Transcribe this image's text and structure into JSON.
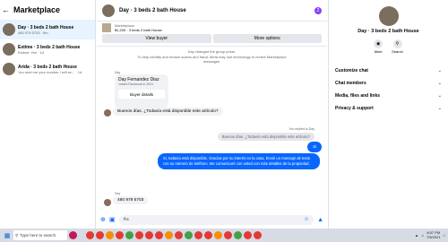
{
  "left": {
    "title": "Marketplace",
    "conversations": [
      {
        "title": "Day · 3 beds 2 bath House",
        "sub": "480 979 5703 · 8m"
      },
      {
        "title": "Estime · 3 beds 2 bath House",
        "sub": "Estime: Yes · 1d"
      },
      {
        "title": "Arida · 3 beds 2 bath House",
        "sub": "You sent me your number I will se... · 1d"
      }
    ]
  },
  "chat": {
    "title": "Day · 3 beds 2 bath House",
    "badge": "2",
    "listing_caption": "Marketplace",
    "listing_price": "$1,200 · 3 beds 2 bath House",
    "view_buyer": "View buyer",
    "more_options": "More options",
    "sys1": "Day changed the group photo.",
    "sys2": "To help identify and reduce scams and fraud, Meta may use technology to review Marketplace messages.",
    "sender_label": "Day",
    "card_name": "Day Fernandez Diaz",
    "card_sub": "Joined Facebook in 2021",
    "card_button": "Buyer details",
    "msg_in_1": "Buenos días. ¿Todavía está disponible este artículo?",
    "replied_label": "You replied to Day",
    "reply_quote": "Buenos días. ¿Todavía está disponible este artículo?",
    "msg_out_short": "Si",
    "msg_out_long": "Si, todavía está disponible. Gracias por su interés en la casa. Envié un mensaje de texto con su número de teléfono. Me comunicaré con usted con más detalles de la propiedad.",
    "sender_label_2": "Day",
    "msg_in_2": "480 979 5703",
    "composer_placeholder": "Aa"
  },
  "right": {
    "name": "Day · 3 beds 2 bath House",
    "mute": "Mute",
    "search": "Search",
    "sections": [
      "Customize chat",
      "Chat members",
      "Media, files and links",
      "Privacy & support"
    ]
  },
  "taskbar": {
    "search_text": "Type here to search",
    "time": "8:57 PM",
    "date": "7/5/2021"
  },
  "colors": {
    "accent": "#0866ff",
    "selected": "#e7f3ff"
  }
}
